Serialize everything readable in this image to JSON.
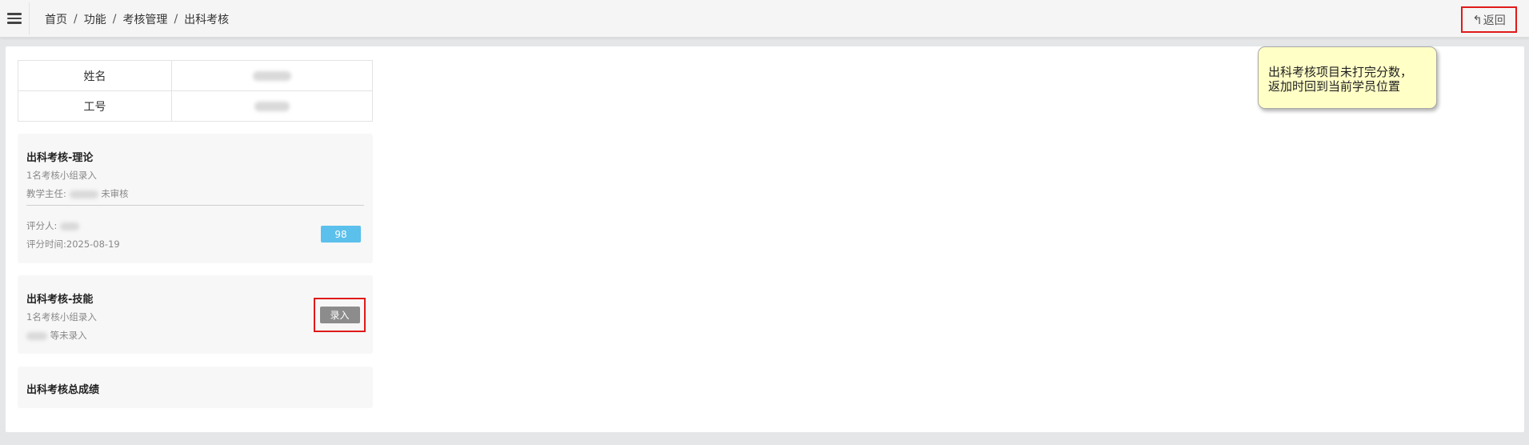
{
  "breadcrumb": {
    "items": [
      "首页",
      "功能",
      "考核管理",
      "出科考核"
    ],
    "separator": "/"
  },
  "back_button": {
    "label": "返回",
    "icon": "reply-arrow-icon"
  },
  "info": {
    "name_label": "姓名",
    "staff_id_label": "工号"
  },
  "cards": {
    "theory": {
      "title": "出科考核-理论",
      "group_note": "1名考核小组录入",
      "director_prefix": "教学主任:",
      "director_status": "未审核",
      "scorer_prefix": "评分人:",
      "score_time": "评分时间:2025-08-19",
      "score": "98"
    },
    "skill": {
      "title": "出科考核-技能",
      "group_note": "1名考核小组录入",
      "pending_suffix": "等未录入",
      "enter_label": "录入"
    },
    "total": {
      "title": "出科考核总成绩"
    }
  },
  "annotation": {
    "line1": "出科考核项目未打完分数，",
    "line2": "返加时回到当前学员位置"
  },
  "colors": {
    "score_badge": "#5bc0ec",
    "enter_button": "#8c8c8c",
    "highlight_border": "#e01a1a",
    "note_background": "#ffffc6"
  }
}
